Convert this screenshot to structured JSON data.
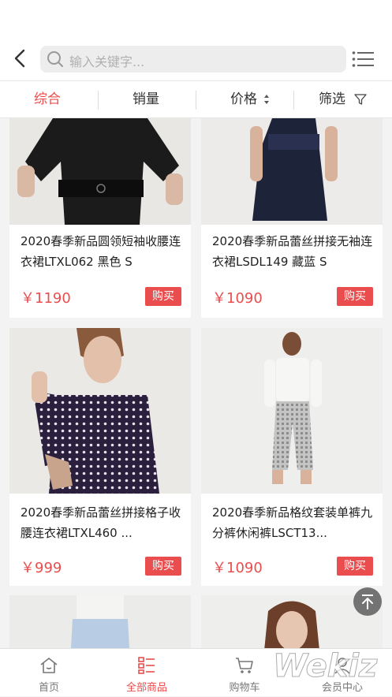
{
  "search": {
    "placeholder": "输入关键字..."
  },
  "tabs": [
    {
      "label": "综合",
      "active": true
    },
    {
      "label": "销量",
      "active": false
    },
    {
      "label": "价格",
      "active": false
    },
    {
      "label": "筛选",
      "active": false
    }
  ],
  "products": [
    {
      "title": "2020春季新品圆领短袖收腰连衣裙LTXL062 黑色 S",
      "price": "￥1190",
      "buy": "购买"
    },
    {
      "title": "2020春季新品蕾丝拼接无袖连衣裙LSDL149 藏蓝 S",
      "price": "￥1090",
      "buy": "购买"
    },
    {
      "title": "2020春季新品蕾丝拼接格子收腰连衣裙LTXL460 ...",
      "price": "￥999",
      "buy": "购买"
    },
    {
      "title": "2020春季新品格纹套装单裤九分裤休闲裤LSCT13...",
      "price": "￥1090",
      "buy": "购买"
    }
  ],
  "bottom_nav": [
    {
      "label": "首页",
      "icon": "home-icon",
      "active": false
    },
    {
      "label": "全部商品",
      "icon": "category-icon",
      "active": true
    },
    {
      "label": "购物车",
      "icon": "cart-icon",
      "active": false
    },
    {
      "label": "会员中心",
      "icon": "user-icon",
      "active": false
    }
  ],
  "watermark": "Wekiz",
  "colors": {
    "accent": "#e94d4d",
    "background": "#f3f3f3"
  }
}
